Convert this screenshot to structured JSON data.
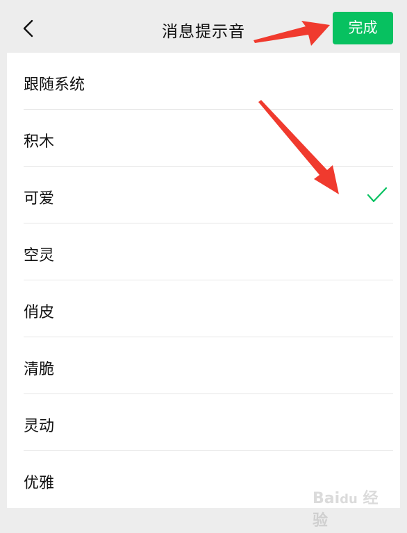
{
  "header": {
    "title": "消息提示音",
    "done_label": "完成"
  },
  "list": {
    "items": [
      {
        "label": "跟随系统",
        "selected": false
      },
      {
        "label": "积木",
        "selected": false
      },
      {
        "label": "可爱",
        "selected": true
      },
      {
        "label": "空灵",
        "selected": false
      },
      {
        "label": "俏皮",
        "selected": false
      },
      {
        "label": "清脆",
        "selected": false
      },
      {
        "label": "灵动",
        "selected": false
      },
      {
        "label": "优雅",
        "selected": false
      }
    ]
  },
  "icons": {
    "back": "chevron-left-icon",
    "check": "checkmark-icon"
  },
  "colors": {
    "accent": "#07c160",
    "annotation_arrow": "#f03a2e"
  },
  "watermark": {
    "text": "Baidu 经验"
  }
}
